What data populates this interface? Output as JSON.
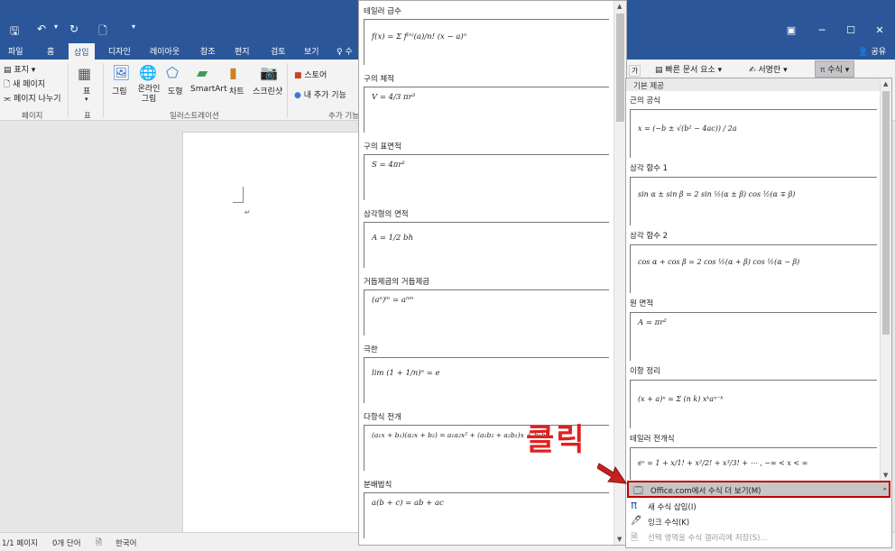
{
  "quick_access": {
    "save": "🖫",
    "undo": "↶",
    "undo_dd": "▾",
    "redo": "↻",
    "new": "🗋",
    "custom": "▾"
  },
  "tabs": [
    "파일",
    "홈",
    "삽입",
    "디자인",
    "레이아웃",
    "참조",
    "편지",
    "검토",
    "보기",
    "♀ 수"
  ],
  "share": "공유",
  "ribbon": {
    "page_group": {
      "cover": "표지",
      "blank": "새 페이지",
      "break": "페이지 나누기",
      "label": "페이지"
    },
    "table_group": {
      "table": "표",
      "label": "표"
    },
    "illus_group": {
      "pictures": "그림",
      "online": "온라인 그림",
      "shapes": "도형",
      "smartart": "SmartArt",
      "chart": "차트",
      "screenshot": "스크린샷",
      "label": "일러스트레이션"
    },
    "addins_group": {
      "store": "스토어",
      "my_addins": "내 추가 기능",
      "label": "추가 기능"
    },
    "right": {
      "quickparts": "빠른 문서 요소",
      "signature": "서명란",
      "equation": "수식"
    }
  },
  "status": {
    "page": "1/1 페이지",
    "words": "0개 단어",
    "lang": "한국어"
  },
  "left_gallery": [
    {
      "title": "테일러 급수",
      "eq": "f(x) = Σ f⁽ⁿ⁾(a)/n! (x − a)ⁿ"
    },
    {
      "title": "구의 체적",
      "eq": "V = 4/3 πr³"
    },
    {
      "title": "구의 표면적",
      "eq": "S = 4πr²"
    },
    {
      "title": "삼각형의 면적",
      "eq": "A = 1/2 bh"
    },
    {
      "title": "거듭제곱의 거듭제곱",
      "eq": "(aⁿ)ᵐ = aⁿᵐ"
    },
    {
      "title": "극한",
      "eq": "lim (1 + 1/n)ⁿ = e"
    },
    {
      "title": "다항식 전개",
      "eq": "(a₁x + b₁)(a₂x + b₂) = a₁a₂x² + (a₁b₂ + a₂b₁)x + b₁b₂"
    },
    {
      "title": "분배법칙",
      "eq": "a(b + c) = ab + ac"
    }
  ],
  "right_gallery": {
    "header": "기본 제공",
    "items": [
      {
        "title": "근의 공식",
        "eq": "x = (−b ± √(b² − 4ac)) / 2a"
      },
      {
        "title": "삼각 함수 1",
        "eq": "sin α ± sin β = 2 sin ½(α ± β) cos ½(α ∓ β)"
      },
      {
        "title": "삼각 함수 2",
        "eq": "cos α + cos β = 2 cos ½(α + β) cos ½(α − β)"
      },
      {
        "title": "원 면적",
        "eq": "A = πr²"
      },
      {
        "title": "이항 정리",
        "eq": "(x + a)ⁿ = Σ (n k) xᵏaⁿ⁻ᵏ"
      },
      {
        "title": "테일러 전개식",
        "eq": "eˣ = 1 + x/1! + x²/2! + x³/3! + ⋯ ,    −∞ < x < ∞"
      }
    ]
  },
  "menu": [
    {
      "label": "Office.com에서 수식 더 보기(M)",
      "icon": "🗔"
    },
    {
      "label": "새 수식 삽입(I)",
      "icon": "π"
    },
    {
      "label": "잉크 수식(K)",
      "icon": "🖊"
    },
    {
      "label": "선택 영역을 수식 갤러리에 저장(S)...",
      "icon": "🗎"
    }
  ],
  "annotation": "클릭",
  "colors": {
    "brand": "#2b579a",
    "highlight": "#c00000",
    "annotation": "#e02020"
  }
}
